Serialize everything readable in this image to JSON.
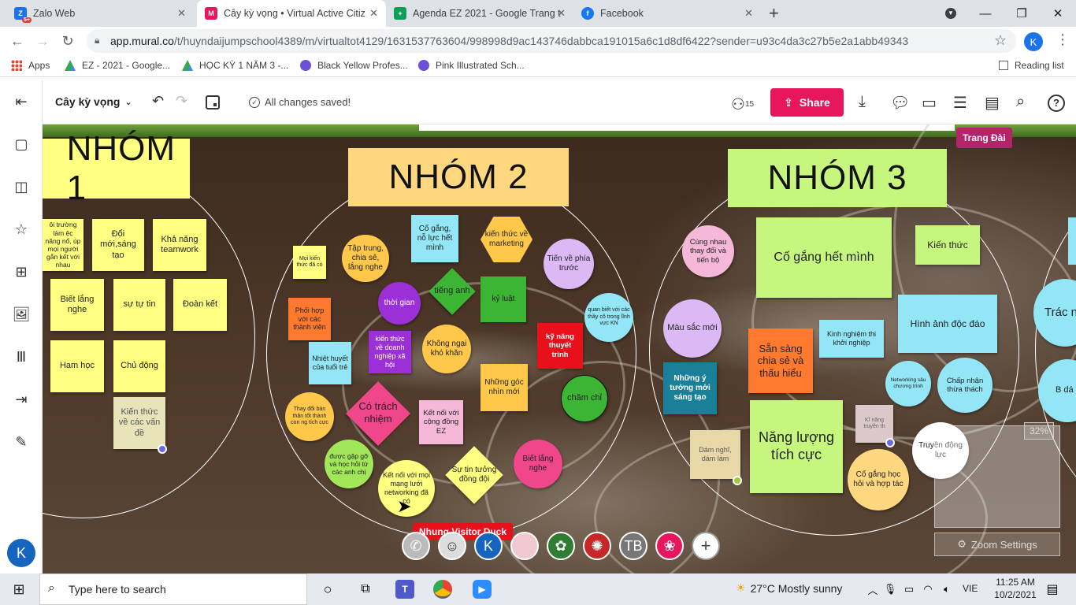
{
  "browser": {
    "tabs": [
      {
        "label": "Zalo Web",
        "icon": "zalo-icon",
        "badge": "5+"
      },
      {
        "label": "Cây kỳ vọng • Virtual Active Citiz",
        "icon": "mural-icon",
        "active": true
      },
      {
        "label": "Agenda EZ 2021 - Google Trang t",
        "icon": "google-sheets-icon"
      },
      {
        "label": "Facebook",
        "icon": "facebook-icon"
      }
    ],
    "url_host": "app.mural.co",
    "url_path": "/t/huyndaijumpschool4389/m/virtualtot4129/1631537763604/998998d9ac143746dabbca191015a6c1d8df6422?sender=u93c4da3c27b5e2a1abb49343",
    "profile_initial": "K",
    "bookmarks": [
      "Apps",
      "EZ - 2021 - Google...",
      "HỌC KỲ 1 NĂM 3 -...",
      "Black Yellow Profes...",
      "Pink Illustrated Sch..."
    ],
    "reading_list": "Reading list"
  },
  "mural": {
    "board_name": "Cây kỳ vọng",
    "save_status": "All changes saved!",
    "members_count": "15",
    "share_label": "Share",
    "collaborator_tag": "Trang Đài",
    "visitor_tag": "Nhung Visitor Duck",
    "zoom_percent": "32%",
    "zoom_settings": "Zoom Settings",
    "user_initial": "K",
    "bottom_avatars": [
      "K",
      "TB"
    ],
    "accent": "#e8175d"
  },
  "groups": {
    "g1": "NHÓM 1",
    "g2": "NHÓM 2",
    "g3": "NHÓM 3"
  },
  "notes1": {
    "a": "ôi trường làm ệc năng nổ, úp mọi người gắn kết với nhau",
    "b": "Đổi mới,sáng tạo",
    "c": "Khả năng teamwork",
    "d": "Biết lắng nghe",
    "e": "sự tự tin",
    "f": "Đoàn kết",
    "g": "Ham học",
    "h": "Chủ động",
    "i": "Kiến thức về các vấn đề"
  },
  "notes2": {
    "a": "Cố gắng, nỗ lực hết mình",
    "b": "kiến thức về marketing",
    "c": "Tập trung, chia sẻ, lắng nghe",
    "d": "Mọi kiến thức đã có",
    "e": "Tiến về phía trước",
    "f": "tiếng anh",
    "g": "thời gian",
    "h": "kỷ luật",
    "i": "quan biết với các thầy cô trong lĩnh vực KN",
    "j": "Phối hợp với các thành viên",
    "k": "kiến thức về doanh nghiệp xã hội",
    "l": "Không ngại khó khăn",
    "m": "kỹ năng thuyết trình",
    "n": "Nhiệt huyết của tuổi trẻ",
    "o": "Những góc nhìn mới",
    "p": "chăm chỉ",
    "q": "Thay đổi bản thân tốt thành con ng tích cực",
    "r": "Có trách nhiệm",
    "s": "Kết nối với cộng đồng EZ",
    "t": "được gặp gỡ và học hỏi từ các anh chị",
    "u": "Kết nối với mọi mạng lưới networking đã có",
    "v": "Sự tin tưởng đồng đội",
    "w": "Biết lắng nghe"
  },
  "notes3": {
    "a": "Cùng nhau thay đổi và tiến bộ",
    "b": "Cố gắng hết mình",
    "c": "Kiến thức",
    "d": "Màu sắc mới",
    "e": "Sẵn sàng chia sẻ và thấu hiểu",
    "f": "Kinh nghiệm thi khởi nghiệp",
    "g": "Hình ảnh độc đáo",
    "h": "Những ý tưởng mới sáng tạo",
    "i": "Networking sâu chương trình",
    "j": "Chấp nhận thừa thách",
    "k": "Dám nghĩ, dám làm",
    "l": "Năng lượng tích cực",
    "m": "Kĩ năng truyền th",
    "n": "Cố gắng học hỏi và hợp tác",
    "o": "Truyền động lực"
  },
  "notes4": {
    "a": "Trác nhiệ",
    "b": "B dá d"
  },
  "taskbar": {
    "search_placeholder": "Type here to search",
    "weather": "27°C  Mostly sunny",
    "lang": "VIE",
    "time": "11:25 AM",
    "date": "10/2/2021"
  }
}
